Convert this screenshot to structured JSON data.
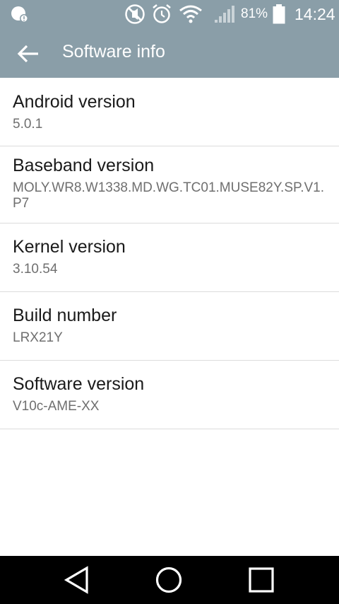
{
  "status_bar": {
    "battery_percent": "81%",
    "time": "14:24",
    "icons": [
      "notification-icon",
      "mute-icon",
      "alarm-icon",
      "wifi-icon",
      "signal-icon",
      "battery-icon"
    ]
  },
  "header": {
    "title": "Software info",
    "back_icon": "arrow-back-icon"
  },
  "items": [
    {
      "label": "Android version",
      "value": "5.0.1"
    },
    {
      "label": "Baseband version",
      "value": "MOLY.WR8.W1338.MD.WG.TC01.MUSE82Y.SP.V1.P7"
    },
    {
      "label": "Kernel version",
      "value": "3.10.54"
    },
    {
      "label": "Build number",
      "value": "LRX21Y"
    },
    {
      "label": "Software version",
      "value": "V10c-AME-XX"
    }
  ],
  "navigation": {
    "icons": [
      "back-triangle-icon",
      "home-circle-icon",
      "recents-square-icon"
    ]
  },
  "colors": {
    "toolbar": "#8a9ea8",
    "background": "#ffffff",
    "nav_bar": "#000000",
    "title_text": "#1a1a1a",
    "value_text": "#6f6f6f",
    "divider": "#dcdcdc"
  }
}
